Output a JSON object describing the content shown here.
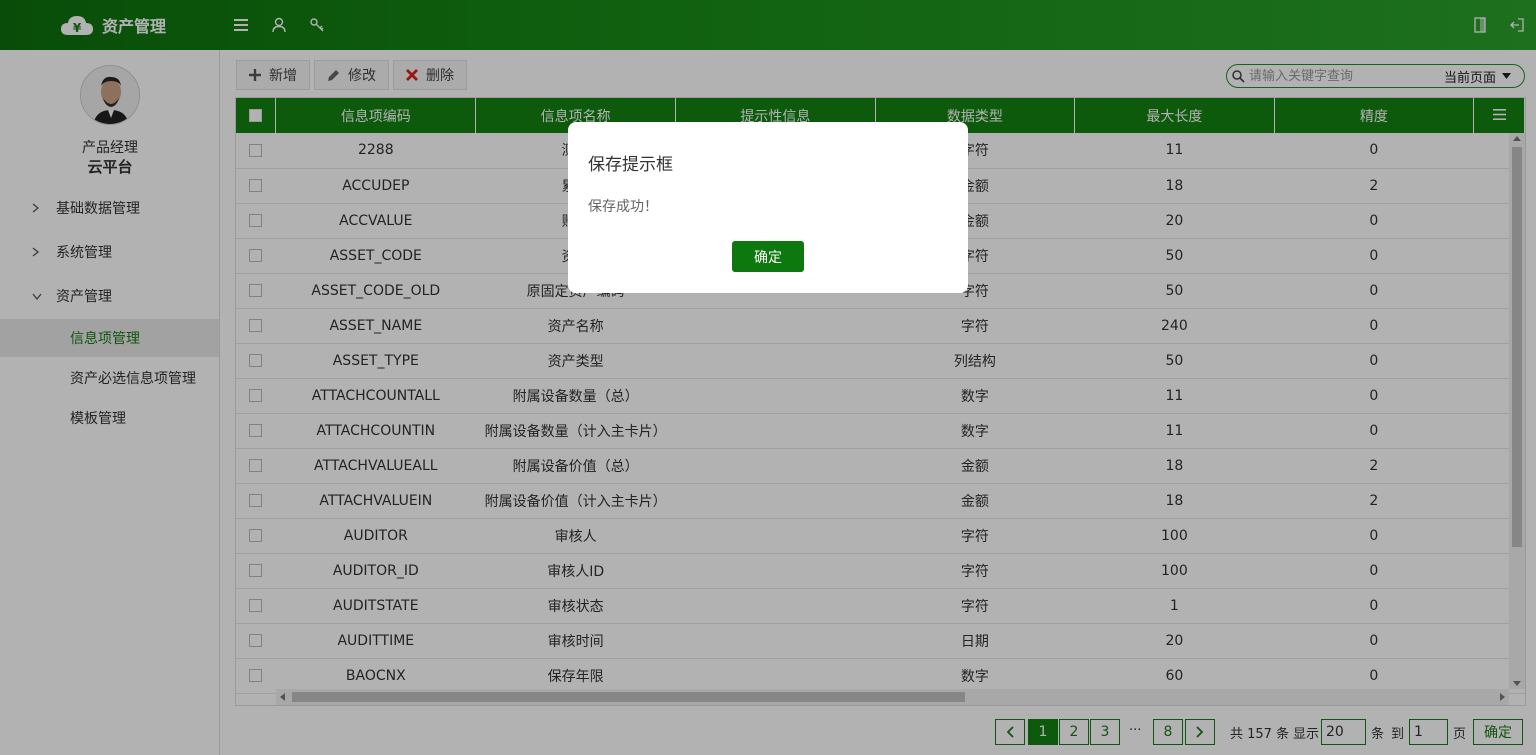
{
  "header": {
    "title": "资产管理",
    "icons": [
      "menu-icon",
      "user-icon",
      "key-icon",
      "fullscreen-icon",
      "logout-icon"
    ]
  },
  "sidebar": {
    "user_role": "产品经理",
    "user_org": "云平台",
    "menu": [
      {
        "label": "基础数据管理",
        "expanded": false
      },
      {
        "label": "系统管理",
        "expanded": false
      },
      {
        "label": "资产管理",
        "expanded": true
      }
    ],
    "submenu": [
      {
        "label": "信息项管理",
        "active": true
      },
      {
        "label": "资产必选信息项管理",
        "active": false
      },
      {
        "label": "模板管理",
        "active": false
      }
    ]
  },
  "toolbar": {
    "add_label": "新增",
    "edit_label": "修改",
    "delete_label": "删除"
  },
  "search": {
    "placeholder": "请输入关键字查询",
    "scope": "当前页面"
  },
  "table": {
    "columns": [
      "信息项编码",
      "信息项名称",
      "提示性信息",
      "数据类型",
      "最大长度",
      "精度"
    ],
    "rows": [
      [
        "2288",
        "测试",
        "",
        "字符",
        "11",
        "0"
      ],
      [
        "ACCUDEP",
        "累计",
        "",
        "金额",
        "18",
        "2"
      ],
      [
        "ACCVALUE",
        "账面",
        "",
        "金额",
        "20",
        "0"
      ],
      [
        "ASSET_CODE",
        "资产",
        "",
        "字符",
        "50",
        "0"
      ],
      [
        "ASSET_CODE_OLD",
        "原固定资产编码",
        "",
        "字符",
        "50",
        "0"
      ],
      [
        "ASSET_NAME",
        "资产名称",
        "",
        "字符",
        "240",
        "0"
      ],
      [
        "ASSET_TYPE",
        "资产类型",
        "",
        "列结构",
        "50",
        "0"
      ],
      [
        "ATTACHCOUNTALL",
        "附属设备数量（总）",
        "",
        "数字",
        "11",
        "0"
      ],
      [
        "ATTACHCOUNTIN",
        "附属设备数量（计入主卡片）",
        "",
        "数字",
        "11",
        "0"
      ],
      [
        "ATTACHVALUEALL",
        "附属设备价值（总）",
        "",
        "金额",
        "18",
        "2"
      ],
      [
        "ATTACHVALUEIN",
        "附属设备价值（计入主卡片）",
        "",
        "金额",
        "18",
        "2"
      ],
      [
        "AUDITOR",
        "审核人",
        "",
        "字符",
        "100",
        "0"
      ],
      [
        "AUDITOR_ID",
        "审核人ID",
        "",
        "字符",
        "100",
        "0"
      ],
      [
        "AUDITSTATE",
        "审核状态",
        "",
        "字符",
        "1",
        "0"
      ],
      [
        "AUDITTIME",
        "审核时间",
        "",
        "日期",
        "20",
        "0"
      ],
      [
        "BAOCNX",
        "保存年限",
        "",
        "数字",
        "60",
        "0"
      ]
    ]
  },
  "pager": {
    "pages": [
      "1",
      "2",
      "3"
    ],
    "ellipsis": "···",
    "last_page": "8",
    "total_text": "共 157 条",
    "show_label": "显示",
    "page_size": "20",
    "unit_label": "条",
    "goto_label": "到",
    "goto_value": "1",
    "page_unit": "页",
    "confirm_label": "确定"
  },
  "modal": {
    "title": "保存提示框",
    "message": "保存成功！",
    "ok_label": "确定"
  }
}
